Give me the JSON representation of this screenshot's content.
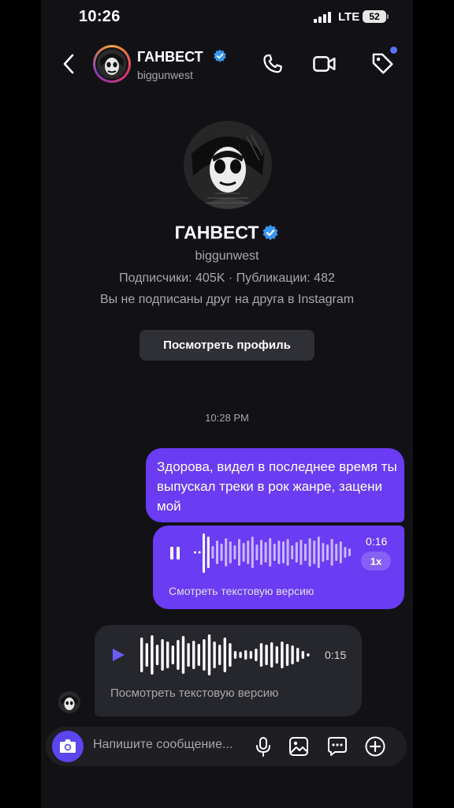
{
  "status_bar": {
    "time": "10:26",
    "network": "LTE",
    "battery": "52"
  },
  "header": {
    "name": "ГАНВЕСТ",
    "username": "biggunwest"
  },
  "profile": {
    "name": "ГАНВЕСТ",
    "username": "biggunwest",
    "stats": "Подписчики: 405K · Публикации: 482",
    "note": "Вы не подписаны друг на друга в Instagram",
    "view_button": "Посмотреть профиль"
  },
  "messages": {
    "timestamp": "10:28 PM",
    "outgoing_text": "Здорова, видел в последнее время ты выпускал треки в рок жанре, зацени мой",
    "outgoing_voice": {
      "duration": "0:16",
      "speed": "1x",
      "transcript_link": "Смотреть текстовую версию"
    },
    "incoming_voice": {
      "duration": "0:15",
      "transcript_link": "Посмотреть текстовую версию"
    }
  },
  "composer": {
    "placeholder": "Напишите сообщение..."
  },
  "colors": {
    "accent": "#6a3cf4",
    "background": "#121216",
    "incoming_bubble": "#26262d",
    "verified": "#3897f0"
  },
  "icons": [
    "back-icon",
    "verified-icon",
    "phone-icon",
    "video-call-icon",
    "tag-icon",
    "pause-icon",
    "play-icon",
    "camera-icon",
    "microphone-icon",
    "gallery-icon",
    "sticker-icon",
    "plus-icon"
  ]
}
